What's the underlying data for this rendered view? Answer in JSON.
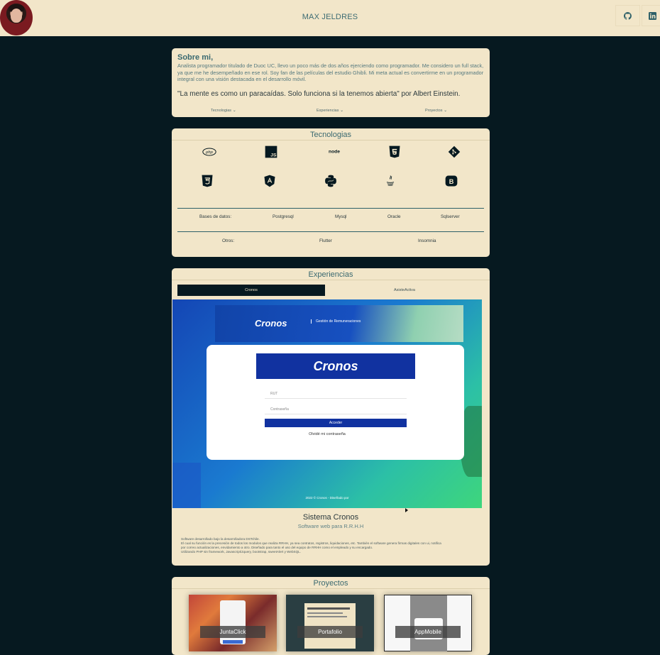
{
  "navbar": {
    "title": "MAX JELDRES",
    "avatar_icon": "user-photo",
    "social": [
      {
        "name": "github-icon"
      },
      {
        "name": "linkedin-icon"
      }
    ]
  },
  "about": {
    "heading": "Sobre mi,",
    "bio": "Analista programador titulado de Duoc UC, llevo un poco más de dos años ejerciendo como programador. Me considero un full stack, ya que me he desempeñado en ese rol. Soy fan de las películas del estudio Ghibli. Mi meta actual es convertirme en un programador integral con una visión destacada en el desarrollo móvil.",
    "quote": "\"La mente es como un paracaídas. Solo funciona si la tenemos abierta\" por Albert Einstein.",
    "links": [
      "Tecnologias",
      "Experiencias",
      "Proyectos"
    ]
  },
  "tech": {
    "title": "Tecnologias",
    "icons": [
      "php-icon",
      "javascript-icon",
      "nodejs-icon",
      "html5-icon",
      "git-icon",
      "css3-icon",
      "angular-icon",
      "python-icon",
      "java-icon",
      "bootstrap-icon"
    ],
    "databases_label": "Bases de datos:",
    "databases": [
      "Postgresql",
      "Mysql",
      "Oracle",
      "Sqlserver"
    ],
    "others_label": "Otros:",
    "others": [
      "Flutter",
      "Insomnia"
    ]
  },
  "experience": {
    "title": "Experiencias",
    "tabs": [
      "Cronos",
      "AsisteActiva"
    ],
    "active_tab": "Cronos",
    "screenshot": {
      "banner_brand": "Cronos",
      "banner_sub": "Gestión de Remuneraciones",
      "login_brand": "Cronos",
      "field_rut": "RUT",
      "field_password": "Contraseña",
      "button": "Acceder",
      "forgot": "Olvidé mi contraseña",
      "footer": "2022 © Cronos - Diseñado por"
    },
    "system_title": "Sistema Cronos",
    "system_subtitle": "Software web para R.R.H.H",
    "description_lines": [
      "Software desarrollado bajo la desarrolladora DSTchile.",
      "El cual su función es la precesión de todos los modulos que realiza RRHH, ya sea contratos, registros, liquidaciones, etc. También el software genera firmas digitales con ui, notifica",
      "por correo actualizaciones, envidamiento a otro. Diseñado para tanto el uso del equipo de RRHH como el empleado y su encargado.",
      "Utilizando PHP sin framework, Javascript/Jquery, bootstrap, sweetAlert y WebSQL."
    ]
  },
  "projects": {
    "title": "Proyectos",
    "items": [
      "JuntaClick",
      "Portafolio",
      "AppMobile"
    ]
  },
  "colors": {
    "background": "#061920",
    "card": "#f2e6c9",
    "accent": "#2e5e66"
  }
}
